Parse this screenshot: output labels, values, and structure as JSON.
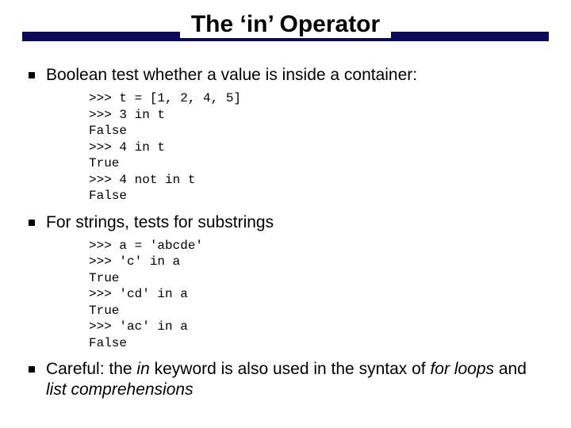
{
  "title": "The ‘in’ Operator",
  "bullets": {
    "b1": "Boolean test whether a value is inside a container:",
    "b2": "For strings, tests for substrings",
    "b3_pre": "Careful: the ",
    "b3_in": "in",
    "b3_mid": " keyword is also used in the syntax of ",
    "b3_for": "for loops",
    "b3_and": " and ",
    "b3_lc": "list comprehensions"
  },
  "code": {
    "block1": ">>> t = [1, 2, 4, 5]\n>>> 3 in t\nFalse\n>>> 4 in t\nTrue\n>>> 4 not in t\nFalse",
    "block2": ">>> a = 'abcde'\n>>> 'c' in a\nTrue\n>>> 'cd' in a\nTrue\n>>> 'ac' in a\nFalse"
  }
}
